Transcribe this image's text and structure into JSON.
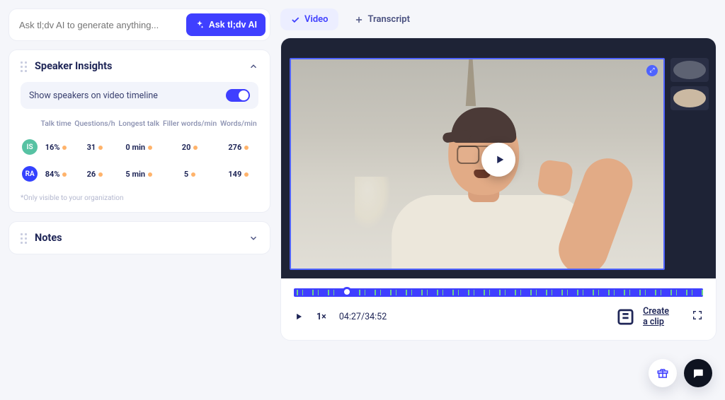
{
  "ai_input": {
    "placeholder": "Ask tl;dv AI to generate anything...",
    "button": "Ask tl;dv AI"
  },
  "panels": {
    "speaker": {
      "title": "Speaker Insights",
      "toggle_label": "Show speakers on video timeline",
      "columns": [
        "Talk time",
        "Questions/h",
        "Longest talk",
        "Filler words/min",
        "Words/min"
      ],
      "rows": [
        {
          "id": "IS",
          "color": "#57c2a3",
          "talk": "16%",
          "q": "31",
          "longest": "0 min",
          "filler": "20",
          "wpm": "276"
        },
        {
          "id": "RA",
          "color": "#3442ff",
          "talk": "84%",
          "q": "26",
          "longest": "5 min",
          "filler": "5",
          "wpm": "149"
        }
      ],
      "footnote": "*Only visible to your organization"
    },
    "notes": {
      "title": "Notes"
    }
  },
  "tabs": {
    "video": "Video",
    "transcript": "Transcript"
  },
  "player": {
    "speed": "1×",
    "time": "04:27/34:52",
    "clip_label": "Create a clip"
  }
}
